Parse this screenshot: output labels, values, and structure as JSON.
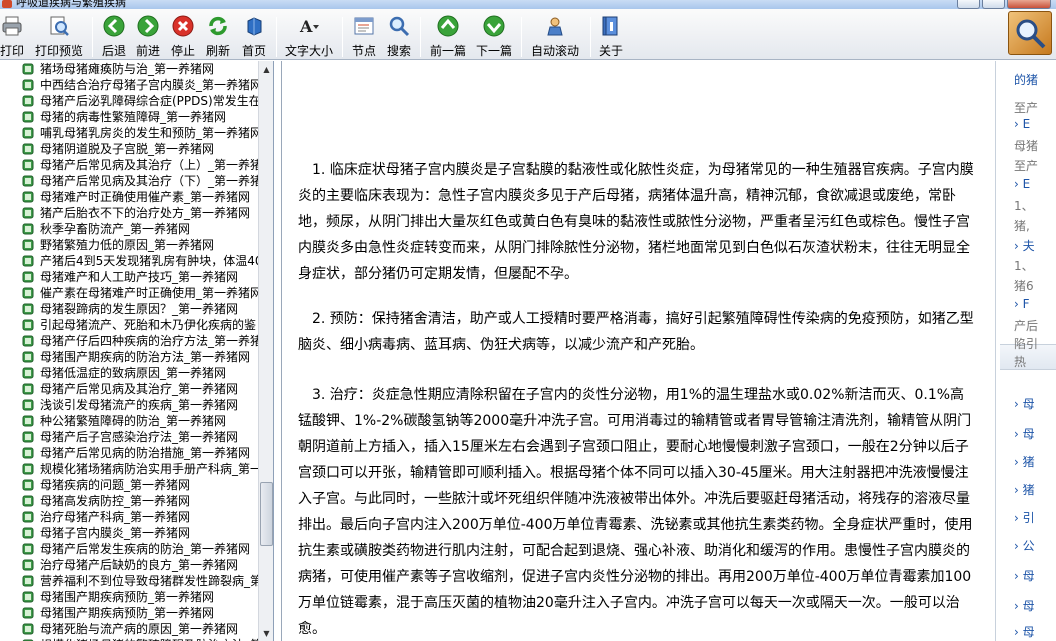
{
  "window": {
    "title": "呼吸道疾病与繁殖疾病"
  },
  "toolbar": {
    "buttons": [
      {
        "id": "print",
        "label": "打印"
      },
      {
        "id": "print_preview",
        "label": "打印预览"
      },
      {
        "id": "back",
        "label": "后退"
      },
      {
        "id": "forward",
        "label": "前进"
      },
      {
        "id": "stop",
        "label": "停止"
      },
      {
        "id": "refresh",
        "label": "刷新"
      },
      {
        "id": "home",
        "label": "首页"
      },
      {
        "id": "font_size",
        "label": "文字大小"
      },
      {
        "id": "nodes",
        "label": "节点"
      },
      {
        "id": "search",
        "label": "搜索"
      },
      {
        "id": "prev",
        "label": "前一篇"
      },
      {
        "id": "next",
        "label": "下一篇"
      },
      {
        "id": "autoscroll",
        "label": "自动滚动"
      },
      {
        "id": "about",
        "label": "关于"
      }
    ]
  },
  "tree": {
    "items": [
      "猪场母猪瘫痪防与治_第一养猪网",
      "中西结合治疗母猪子宫内膜炎_第一养猪网",
      "母猪产后泌乳障碍综合症(PPDS)常发生在母",
      "母猪的病毒性繁殖障碍_第一养猪网",
      "哺乳母猪乳房炎的发生和预防_第一养猪网",
      "母猪阴道脱及子宫脱_第一养猪网",
      "母猪产后常见病及其治疗（上）_第一养猪",
      "母猪产后常见病及其治疗（下）_第一养猪",
      "母猪难产时正确使用催产素_第一养猪网",
      "猪产后胎衣不下的治疗处方_第一养猪网",
      "秋季孕畜防流产_第一养猪网",
      "野猪繁殖力低的原因_第一养猪网",
      "产猪后4到5天发现猪乳房有肿块，体温40",
      "母猪难产和人工助产技巧_第一养猪网",
      "催产素在母猪难产时正确使用_第一养猪网",
      "母猪裂蹄病的发生原因？_第一养猪网",
      "引起母猪流产、死胎和木乃伊化疾病的鉴",
      "母猪产仔后四种疾病的治疗方法_第一养猪",
      "母猪围产期疾病的防治方法_第一养猪网",
      "母猪低温症的致病原因_第一养猪网",
      "母猪产后常见病及其治疗_第一养猪网",
      "浅谈引发母猪流产的疾病_第一养猪网",
      "种公猪繁殖障碍的防治_第一养猪网",
      "母猪产后子宫感染治疗法_第一养猪网",
      "母猪产后常见病的防治措施_第一养猪网",
      "规模化猪场猪病防治实用手册产科病_第一",
      "母猪疾病的问题_第一养猪网",
      "母猪高发病防控_第一养猪网",
      "治疗母猪产科病_第一养猪网",
      "母猪子宫内膜炎_第一养猪网",
      "母猪产后常发生疾病的防治_第一养猪网",
      "治疗母猪产后缺奶的良方_第一养猪网",
      "营养福利不到位导致母猪群发性蹄裂病_第",
      "母猪围产期疾病预防_第一养猪网",
      "母猪围产期疾病预防_第一养猪网",
      "母猪死胎与流产病的原因_第一养猪网",
      "规模化猪场母猪的繁殖障碍及防治方法_第"
    ]
  },
  "article": {
    "paragraphs": [
      "1. 临床症状母猪子宫内膜炎是子宫黏膜的黏液性或化脓性炎症，为母猪常见的一种生殖器官疾病。子宫内膜炎的主要临床表现为：急性子宫内膜炎多见于产后母猪，病猪体温升高，精神沉郁，食欲减退或废绝，常卧地，频尿，从阴门排出大量灰红色或黄白色有臭味的黏液性或脓性分泌物，严重者呈污红色或棕色。慢性子宫内膜炎多由急性炎症转变而来，从阴门排除脓性分泌物，猪栏地面常见到白色似石灰渣状粉末，往往无明显全身症状，部分猪仍可定期发情，但屡配不孕。",
      "2. 预防：保持猪舍清洁，助产或人工授精时要严格消毒，搞好引起繁殖障碍性传染病的免疫预防，如猪乙型脑炎、细小病毒病、蓝耳病、伪狂犬病等，以减少流产和产死胎。",
      "3. 治疗：炎症急性期应清除积留在子宫内的炎性分泌物，用1%的温生理盐水或0.02%新洁而灭、0.1%高锰酸钾、1%-2%碳酸氢钠等2000毫升冲洗子宫。可用消毒过的输精管或者胃导管输注清洗剂，输精管从阴门朝阴道前上方插入，插入15厘米左右会遇到子宫颈口阻止，要耐心地慢慢刺激子宫颈口，一般在2分钟以后子宫颈口可以开张，输精管即可顺利插入。根据母猪个体不同可以插入30-45厘米。用大注射器把冲洗液慢慢注入子宫。与此同时，一些脓汁或坏死组织伴随冲洗液被带出体外。冲洗后要驱赶母猪活动，将残存的溶液尽量排出。最后向子宫内注入200万单位-400万单位青霉素、洗铋素或其他抗生素类药物。全身症状严重时，使用抗生素或磺胺类药物进行肌内注射，可配合起到退烧、强心补液、助消化和缓泻的作用。患慢性子宫内膜炎的病猪，可使用催产素等子宫收缩剂，促进子宫内炎性分泌物的排出。再用200万单位-400万单位青霉素加100万单位链霉素，混于高压灭菌的植物油20毫升注入子宫内。冲洗子宫可以每天一次或隔天一次。一般可以治愈。"
    ]
  },
  "right_panel": {
    "lines": [
      "的猪",
      "至产",
      "› E",
      "母猪",
      "至产",
      "› E",
      "1、",
      "猪,",
      "› 夫",
      "1、",
      "猪6",
      "› F",
      "产后",
      "陷引",
      "热",
      "› 母",
      "› 母",
      "› 猪",
      "› 猪",
      "› 引",
      "› 公",
      "› 母",
      "› 母",
      "› 母",
      "› 后"
    ]
  }
}
